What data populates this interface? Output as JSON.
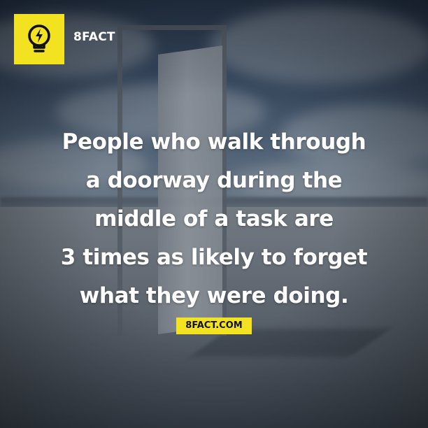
{
  "brand": {
    "name": "8FACT",
    "logo_icon": "lightbulb-bolt-icon",
    "accent_color": "#f3e21f"
  },
  "fact": {
    "lines": [
      "People who walk through",
      "a doorway during the",
      "middle of a task are",
      "3 times as likely to forget",
      "what they were doing."
    ]
  },
  "footer": {
    "url": "8FACT.COM"
  }
}
